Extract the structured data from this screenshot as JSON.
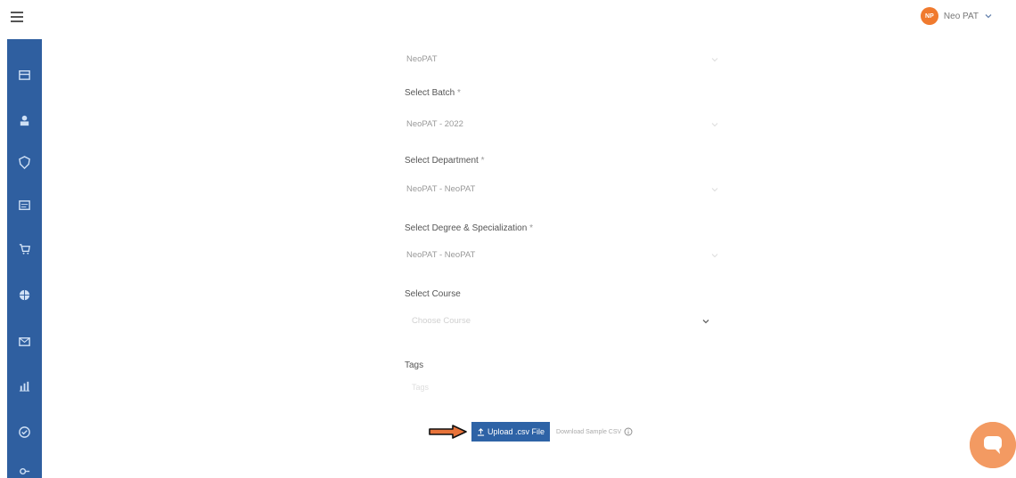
{
  "header": {
    "user_name": "Neo PAT",
    "avatar_initials": "NP"
  },
  "sidebar": {
    "icons": [
      "briefcase-icon",
      "group-icon",
      "shield-icon",
      "chat-icon",
      "cart-icon",
      "globe-icon",
      "mail-icon",
      "bar-chart-icon",
      "check-circle-icon",
      "key-icon"
    ]
  },
  "form": {
    "institution_value": "NeoPAT",
    "batch_label": "Select Batch",
    "batch_value": "NeoPAT - 2022",
    "department_label": "Select Department",
    "department_value": "NeoPAT - NeoPAT",
    "degree_label": "Select Degree & Specialization",
    "degree_value": "NeoPAT - NeoPAT",
    "course_label": "Select Course",
    "course_placeholder": "Choose Course",
    "tags_label": "Tags",
    "tags_placeholder": "Tags",
    "required_mark": "*"
  },
  "actions": {
    "upload_label": "Upload .csv File",
    "download_sample_label": "Download Sample CSV"
  },
  "colors": {
    "sidebar": "#2f5fa0",
    "primary_button": "#2e63a6",
    "avatar": "#f07a2e",
    "chat_bubble": "#f39a62",
    "arrow_annotation": "#e8733a"
  }
}
